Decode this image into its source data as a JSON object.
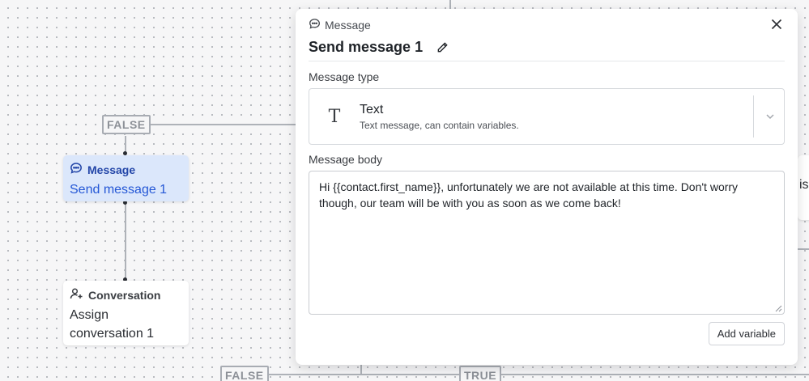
{
  "canvas": {
    "false_tag_top": "FALSE",
    "false_tag_bottom": "FALSE",
    "true_tag_bottom": "TRUE",
    "right_peek_text": "is"
  },
  "nodes": {
    "message_node": {
      "kind": "Message",
      "title": "Send message 1"
    },
    "conversation_node": {
      "kind": "Conversation",
      "title_line1": "Assign",
      "title_line2": "conversation 1"
    }
  },
  "panel": {
    "kind": "Message",
    "title": "Send message 1",
    "message_type_label": "Message type",
    "message_type": {
      "title": "Text",
      "description": "Text message, can contain variables."
    },
    "message_body_label": "Message body",
    "message_body": "Hi {{contact.first_name}}, unfortunately we are not available at this time. Don't worry though, our team will be with you as soon as we come back!",
    "add_variable_label": "Add variable"
  },
  "colors": {
    "selected_node_bg": "#dbe7fb",
    "selected_node_text": "#2457d6",
    "connector": "#aeb2b8"
  },
  "icons": {
    "message_icon": "chat-bubble-icon",
    "conversation_icon": "user-plus-icon",
    "close_icon": "close-icon",
    "edit_icon": "pencil-icon",
    "text_type_icon": "text-t-icon",
    "dropdown_icon": "chevron-down-icon"
  }
}
